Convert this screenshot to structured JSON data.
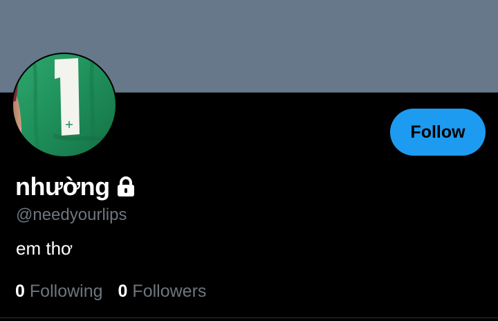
{
  "profile": {
    "display_name": "nhường",
    "handle": "@needyourlips",
    "bio": "em thơ",
    "protected_icon": "lock-icon",
    "avatar_icon": "green-jersey-number-1"
  },
  "actions": {
    "follow_label": "Follow"
  },
  "stats": {
    "following_count": "0",
    "following_label": "Following",
    "followers_count": "0",
    "followers_label": "Followers"
  },
  "colors": {
    "banner": "#66788a",
    "background": "#000000",
    "accent": "#1d9bf0",
    "secondary_text": "#6e767d"
  }
}
